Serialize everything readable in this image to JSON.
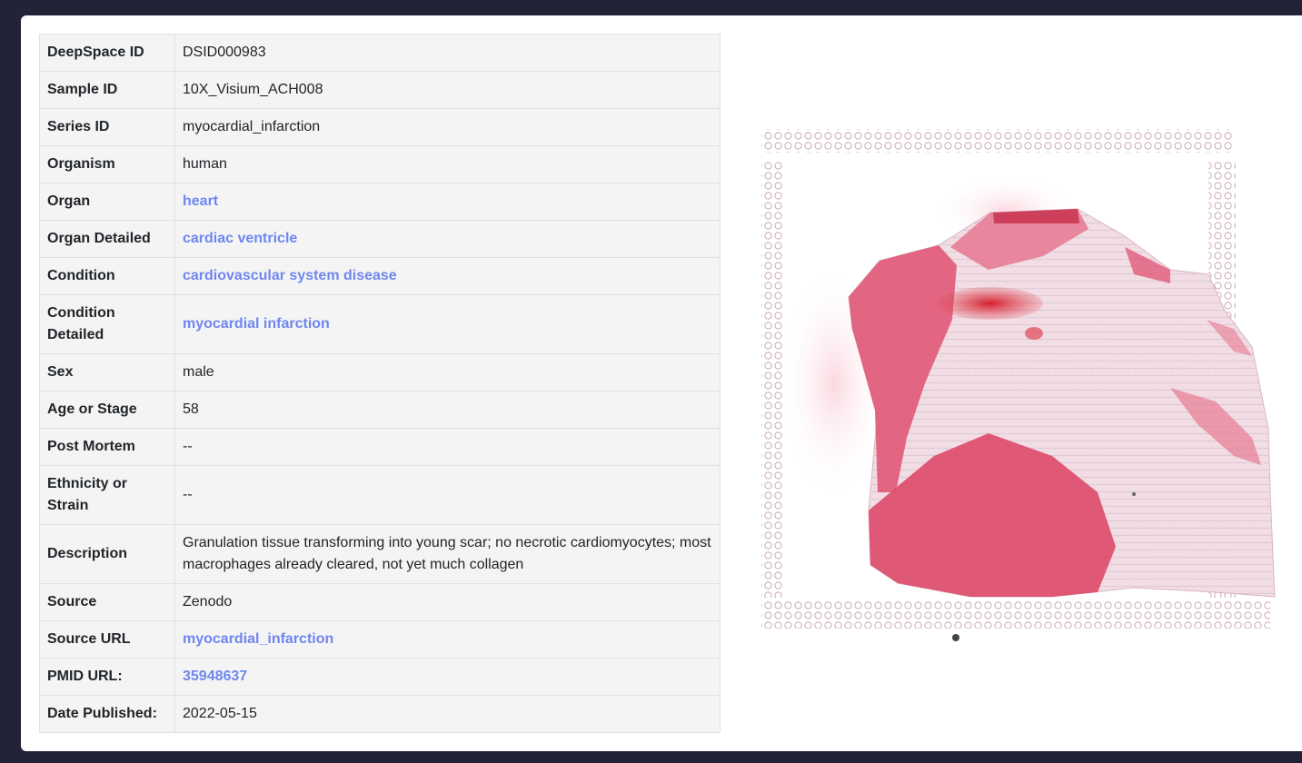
{
  "rows": [
    {
      "label": "DeepSpace ID",
      "value": "DSID000983",
      "link": false
    },
    {
      "label": "Sample ID",
      "value": "10X_Visium_ACH008",
      "link": false
    },
    {
      "label": "Series ID",
      "value": "myocardial_infarction",
      "link": false
    },
    {
      "label": "Organism",
      "value": "human",
      "link": false
    },
    {
      "label": "Organ",
      "value": "heart",
      "link": true
    },
    {
      "label": "Organ Detailed",
      "value": "cardiac ventricle",
      "link": true
    },
    {
      "label": "Condition",
      "value": "cardiovascular system disease",
      "link": true
    },
    {
      "label": "Condition Detailed",
      "value": "myocardial infarction",
      "link": true
    },
    {
      "label": "Sex",
      "value": "male",
      "link": false
    },
    {
      "label": "Age or Stage",
      "value": "58",
      "link": false
    },
    {
      "label": "Post Mortem",
      "value": "--",
      "link": false
    },
    {
      "label": "Ethnicity or Strain",
      "value": "--",
      "link": false
    },
    {
      "label": "Description",
      "value": "Granulation tissue transforming into young scar; no necrotic cardiomyocytes; most macrophages already cleared, not yet much collagen",
      "link": false
    },
    {
      "label": "Source",
      "value": "Zenodo",
      "link": false
    },
    {
      "label": "Source URL",
      "value": "myocardial_infarction",
      "link": true
    },
    {
      "label": "PMID URL:",
      "value": "35948637",
      "link": true
    },
    {
      "label": "Date Published:",
      "value": "2022-05-15",
      "link": false
    }
  ],
  "colors": {
    "page_background": "#222337",
    "card_background": "#ffffff",
    "cell_background": "#f4f4f4",
    "link": "#6f86f0",
    "tissue_stain": "#d94a6a"
  }
}
